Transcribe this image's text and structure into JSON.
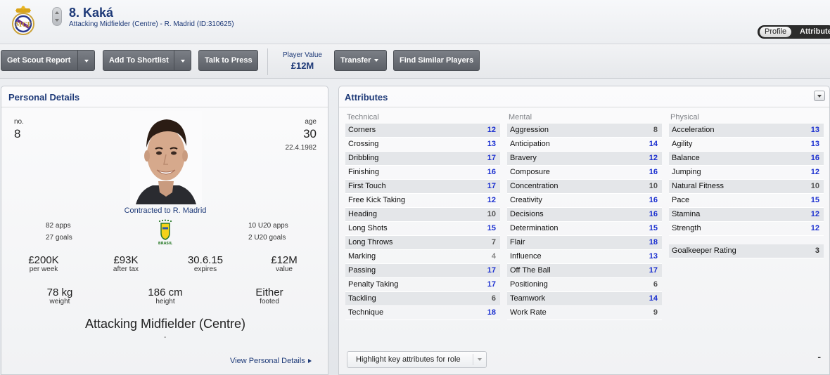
{
  "header": {
    "name": "8. Kaká",
    "subtitle": "Attacking Midfielder (Centre) - R. Madrid (ID:310625)",
    "club_crest_icon": "real-madrid-crest-icon",
    "toggle": {
      "profile": "Profile",
      "attributes": "Attributes"
    }
  },
  "toolbar": {
    "scout_report": "Get Scout Report",
    "add_shortlist": "Add To Shortlist",
    "talk_press": "Talk to Press",
    "player_value_label": "Player Value",
    "player_value": "£12M",
    "transfer": "Transfer",
    "find_similar": "Find Similar Players"
  },
  "personal": {
    "title": "Personal Details",
    "no_label": "no.",
    "no_value": "8",
    "age_label": "age",
    "age_value": "30",
    "dob": "22.4.1982",
    "contract": "Contracted to R. Madrid",
    "apps": "82 apps",
    "goals": "27 goals",
    "u20_apps": "10 U20 apps",
    "u20_goals": "2 U20 goals",
    "nation_badge_icon": "brasil-crest-icon",
    "wage": {
      "value": "£200K",
      "label": "per week"
    },
    "after_tax": {
      "value": "£93K",
      "label": "after tax"
    },
    "expires": {
      "value": "30.6.15",
      "label": "expires"
    },
    "value": {
      "value": "£12M",
      "label": "value"
    },
    "weight": {
      "value": "78 kg",
      "label": "weight"
    },
    "height": {
      "value": "186 cm",
      "label": "height"
    },
    "footed": {
      "value": "Either",
      "label": "footed"
    },
    "position": "Attacking Midfielder (Centre)",
    "dash": "-",
    "view_link": "View Personal Details"
  },
  "attributes": {
    "title": "Attributes",
    "technical": {
      "heading": "Technical",
      "rows": [
        {
          "name": "Corners",
          "value": "12",
          "color": "#1a2fd0"
        },
        {
          "name": "Crossing",
          "value": "13",
          "color": "#1a2fd0"
        },
        {
          "name": "Dribbling",
          "value": "17",
          "color": "#1a2fd0"
        },
        {
          "name": "Finishing",
          "value": "16",
          "color": "#1a2fd0"
        },
        {
          "name": "First Touch",
          "value": "17",
          "color": "#1a2fd0"
        },
        {
          "name": "Free Kick Taking",
          "value": "12",
          "color": "#1a2fd0"
        },
        {
          "name": "Heading",
          "value": "10",
          "color": "#555555"
        },
        {
          "name": "Long Shots",
          "value": "15",
          "color": "#1a2fd0"
        },
        {
          "name": "Long Throws",
          "value": "7",
          "color": "#555555"
        },
        {
          "name": "Marking",
          "value": "4",
          "color": "#888888"
        },
        {
          "name": "Passing",
          "value": "17",
          "color": "#1a2fd0"
        },
        {
          "name": "Penalty Taking",
          "value": "17",
          "color": "#1a2fd0"
        },
        {
          "name": "Tackling",
          "value": "6",
          "color": "#555555"
        },
        {
          "name": "Technique",
          "value": "18",
          "color": "#1a2fd0"
        }
      ]
    },
    "mental": {
      "heading": "Mental",
      "rows": [
        {
          "name": "Aggression",
          "value": "8",
          "color": "#555555"
        },
        {
          "name": "Anticipation",
          "value": "14",
          "color": "#1a2fd0"
        },
        {
          "name": "Bravery",
          "value": "12",
          "color": "#1a2fd0"
        },
        {
          "name": "Composure",
          "value": "16",
          "color": "#1a2fd0"
        },
        {
          "name": "Concentration",
          "value": "10",
          "color": "#555555"
        },
        {
          "name": "Creativity",
          "value": "16",
          "color": "#1a2fd0"
        },
        {
          "name": "Decisions",
          "value": "16",
          "color": "#1a2fd0"
        },
        {
          "name": "Determination",
          "value": "15",
          "color": "#1a2fd0"
        },
        {
          "name": "Flair",
          "value": "18",
          "color": "#1a2fd0"
        },
        {
          "name": "Influence",
          "value": "13",
          "color": "#1a2fd0"
        },
        {
          "name": "Off The Ball",
          "value": "17",
          "color": "#1a2fd0"
        },
        {
          "name": "Positioning",
          "value": "6",
          "color": "#555555"
        },
        {
          "name": "Teamwork",
          "value": "14",
          "color": "#1a2fd0"
        },
        {
          "name": "Work Rate",
          "value": "9",
          "color": "#555555"
        }
      ]
    },
    "physical": {
      "heading": "Physical",
      "rows": [
        {
          "name": "Acceleration",
          "value": "13",
          "color": "#1a2fd0"
        },
        {
          "name": "Agility",
          "value": "13",
          "color": "#1a2fd0"
        },
        {
          "name": "Balance",
          "value": "16",
          "color": "#1a2fd0"
        },
        {
          "name": "Jumping",
          "value": "12",
          "color": "#1a2fd0"
        },
        {
          "name": "Natural Fitness",
          "value": "10",
          "color": "#555555"
        },
        {
          "name": "Pace",
          "value": "15",
          "color": "#1a2fd0"
        },
        {
          "name": "Stamina",
          "value": "12",
          "color": "#1a2fd0"
        },
        {
          "name": "Strength",
          "value": "12",
          "color": "#1a2fd0"
        }
      ],
      "goalkeeper_rating": {
        "name": "Goalkeeper Rating",
        "value": "3"
      }
    },
    "highlight_select": "Highlight key attributes for role",
    "corner_dash": "-"
  }
}
